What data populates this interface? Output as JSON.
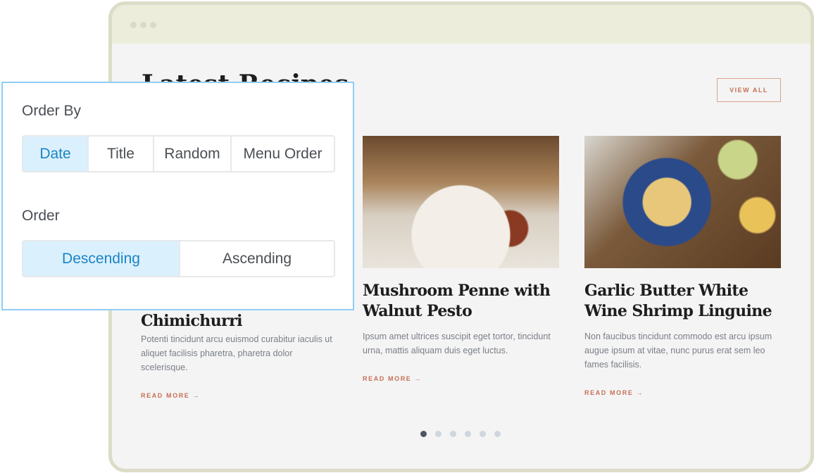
{
  "browser": {
    "dots": 3
  },
  "page": {
    "title": "Latest Recipes",
    "view_all": "VIEW ALL"
  },
  "cards": [
    {
      "title": "Chimichurri",
      "desc": "Potenti tincidunt arcu euismod curabitur iaculis ut aliquet facilisis pharetra, pharetra dolor scelerisque.",
      "more": "READ MORE →"
    },
    {
      "title": "Mushroom Penne with Walnut Pesto",
      "desc": "Ipsum amet ultrices suscipit eget tortor, tincidunt urna, mattis aliquam duis eget luctus.",
      "more": "READ MORE →"
    },
    {
      "title": "Garlic Butter White Wine Shrimp Linguine",
      "desc": "Non faucibus tincidunt commodo est arcu ipsum augue ipsum at vitae, nunc purus erat sem leo fames facilisis.",
      "more": "READ MORE →"
    }
  ],
  "pagination": {
    "count": 6,
    "active": 1
  },
  "panel": {
    "order_by_label": "Order By",
    "order_by_options": [
      "Date",
      "Title",
      "Random",
      "Menu Order"
    ],
    "order_by_selected": "Date",
    "order_label": "Order",
    "order_options": [
      "Descending",
      "Ascending"
    ],
    "order_selected": "Descending"
  },
  "colors": {
    "accent": "#1b84c5",
    "selected_bg": "#dbf0fd",
    "link": "#c76f55"
  }
}
